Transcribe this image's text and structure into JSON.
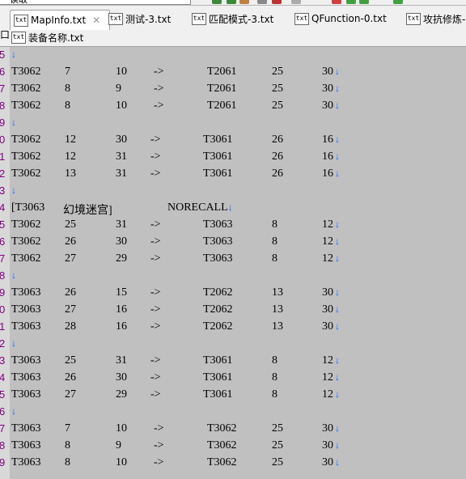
{
  "toolbar": {
    "combo_text": "读取"
  },
  "tabs": [
    {
      "icon": "txt",
      "label": "MapInfo.txt",
      "close": "✕"
    },
    {
      "icon": "txt",
      "label": "测试-3.txt"
    },
    {
      "icon": "txt",
      "label": "匹配模式-3.txt"
    },
    {
      "icon": "txt",
      "label": "QFunction-0.txt"
    },
    {
      "icon": "txt",
      "label": "攻抗修炼-"
    },
    {
      "icon": "txt",
      "label": "装备名称.txt"
    }
  ],
  "left_marker": "口",
  "eol_symbol": "↓",
  "lines": [
    {
      "n": "5",
      "cols": []
    },
    {
      "n": "6",
      "cols": [
        "T3062",
        "7",
        "10",
        "->",
        "T2061",
        "25",
        "30"
      ]
    },
    {
      "n": "7",
      "cols": [
        "T3062",
        "8",
        "9",
        "->",
        "T2061",
        "25",
        "30"
      ]
    },
    {
      "n": "8",
      "cols": [
        "T3062",
        "8",
        "10",
        "->",
        "T2061",
        "25",
        "30"
      ]
    },
    {
      "n": "9",
      "cols": []
    },
    {
      "n": "0",
      "cols": [
        "T3062",
        "12",
        "30",
        "->",
        "T3061",
        "26",
        "16"
      ]
    },
    {
      "n": "1",
      "cols": [
        "T3062",
        "12",
        "31",
        "->",
        "T3061",
        "26",
        "16"
      ]
    },
    {
      "n": "2",
      "cols": [
        "T3062",
        "13",
        "31",
        "->",
        "T3061",
        "26",
        "16"
      ]
    },
    {
      "n": "3",
      "cols": []
    },
    {
      "n": "4",
      "header": [
        "[T3063",
        "幻境迷宫]",
        "NORECALL"
      ]
    },
    {
      "n": "5",
      "cols": [
        "T3062",
        "25",
        "31",
        "->",
        "T3063",
        "8",
        "12"
      ]
    },
    {
      "n": "6",
      "cols": [
        "T3062",
        "26",
        "30",
        "->",
        "T3063",
        "8",
        "12"
      ]
    },
    {
      "n": "7",
      "cols": [
        "T3062",
        "27",
        "29",
        "->",
        "T3063",
        "8",
        "12"
      ]
    },
    {
      "n": "8",
      "cols": []
    },
    {
      "n": "9",
      "cols": [
        "T3063",
        "26",
        "15",
        "->",
        "T2062",
        "13",
        "30"
      ]
    },
    {
      "n": "0",
      "cols": [
        "T3063",
        "27",
        "16",
        "->",
        "T2062",
        "13",
        "30"
      ]
    },
    {
      "n": "1",
      "cols": [
        "T3063",
        "28",
        "16",
        "->",
        "T2062",
        "13",
        "30"
      ]
    },
    {
      "n": "2",
      "cols": []
    },
    {
      "n": "3",
      "cols": [
        "T3063",
        "25",
        "31",
        "->",
        "T3061",
        "8",
        "12"
      ]
    },
    {
      "n": "4",
      "cols": [
        "T3063",
        "26",
        "30",
        "->",
        "T3061",
        "8",
        "12"
      ]
    },
    {
      "n": "5",
      "cols": [
        "T3063",
        "27",
        "29",
        "->",
        "T3061",
        "8",
        "12"
      ]
    },
    {
      "n": "6",
      "cols": []
    },
    {
      "n": "7",
      "cols": [
        "T3063",
        "7",
        "10",
        "->",
        "T3062",
        "25",
        "30"
      ]
    },
    {
      "n": "8",
      "cols": [
        "T3063",
        "8",
        "9",
        "->",
        "T3062",
        "25",
        "30"
      ]
    },
    {
      "n": "9",
      "cols": [
        "T3063",
        "8",
        "10",
        "->",
        "T3062",
        "25",
        "30"
      ]
    }
  ]
}
